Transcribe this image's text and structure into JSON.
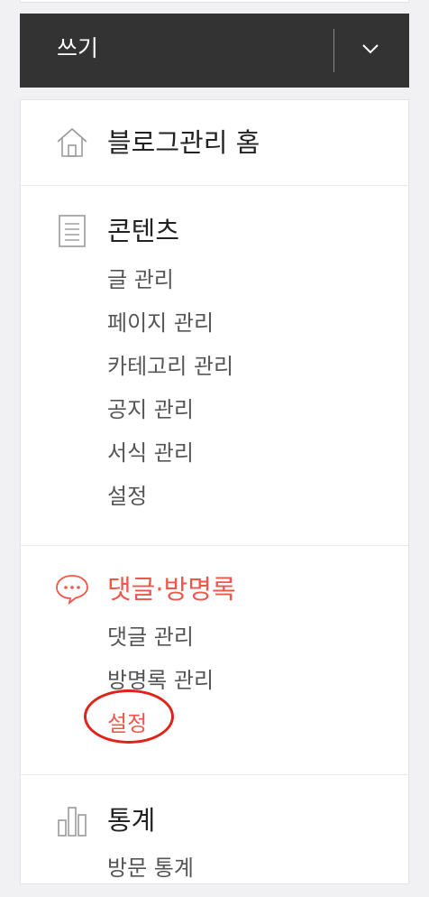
{
  "write": {
    "label": "쓰기"
  },
  "menu": {
    "home": {
      "label": "블로그관리 홈"
    },
    "content": {
      "label": "콘텐츠",
      "items": [
        "글 관리",
        "페이지 관리",
        "카테고리 관리",
        "공지 관리",
        "서식 관리",
        "설정"
      ]
    },
    "comment": {
      "label": "댓글·방명록",
      "items": [
        "댓글 관리",
        "방명록 관리",
        "설정"
      ]
    },
    "stats": {
      "label": "통계",
      "items": [
        "방문 통계"
      ]
    }
  },
  "colors": {
    "accent": "#f0574b",
    "highlight_circle": "#e0231a",
    "write_bar": "#333333"
  }
}
